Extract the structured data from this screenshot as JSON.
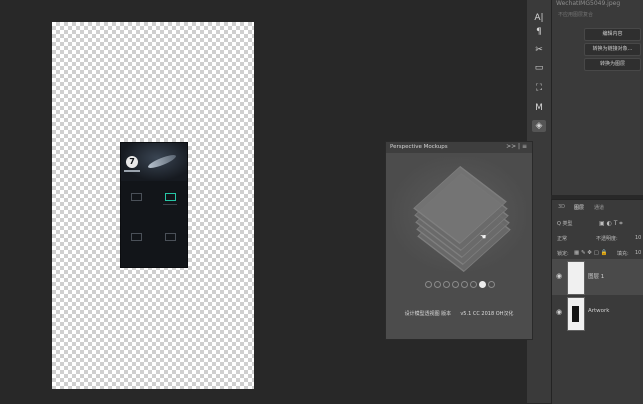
{
  "document": {
    "filename": "WechatIMG5049.jpeg",
    "subtitle": "不应用图层复合"
  },
  "mockup_screen": {
    "logo_glyph": "7"
  },
  "properties": {
    "buttons": [
      "编辑内容",
      "转换为链接对象...",
      "转换为图层"
    ]
  },
  "tools": [
    "A|",
    "¶",
    "✂",
    "▭",
    "⛶",
    "M",
    "◈"
  ],
  "perspective_panel": {
    "title": "Perspective Mockups",
    "controls": ">> | ≡",
    "pager": {
      "count": 8,
      "active_index": 6
    },
    "footer_label": "设计模型透视图 版本",
    "footer_version": "v5.1 CC 2018 OH汉化"
  },
  "layers_panel": {
    "tabs": [
      "3D",
      "图层",
      "通道"
    ],
    "active_tab": 1,
    "filter_label": "Q 类型",
    "blend_mode": "正常",
    "opacity_label": "不透明度:",
    "opacity_value": "10",
    "lock_label": "锁定:",
    "fill_label": "填充:",
    "fill_value": "10",
    "layers": [
      {
        "name": "图层 1",
        "selected": true
      },
      {
        "name": "Artwork",
        "selected": false
      }
    ]
  }
}
